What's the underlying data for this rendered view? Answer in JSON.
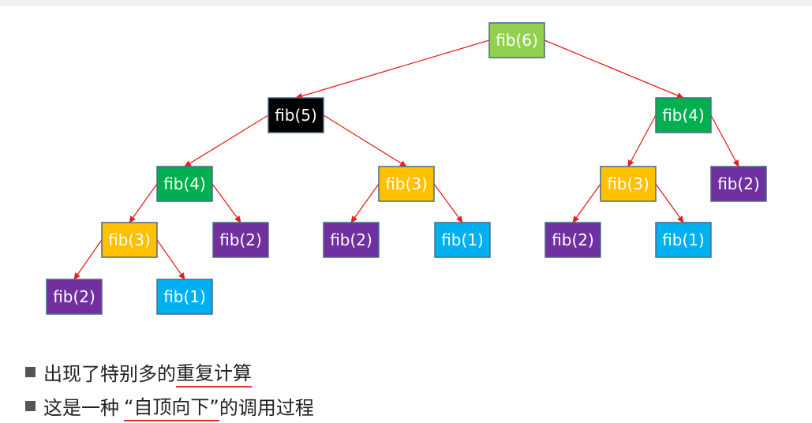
{
  "nodes": [
    {
      "id": "n1",
      "label": "fib(6)",
      "color": "#92d050",
      "parent": null
    },
    {
      "id": "n2",
      "label": "fib(5)",
      "color": "#000000",
      "parent": "n1"
    },
    {
      "id": "n3",
      "label": "fib(4)",
      "color": "#00b050",
      "parent": "n1"
    },
    {
      "id": "n4",
      "label": "fib(4)",
      "color": "#00b050",
      "parent": "n2"
    },
    {
      "id": "n5",
      "label": "fib(3)",
      "color": "#ffc000",
      "parent": "n2"
    },
    {
      "id": "n6",
      "label": "fib(3)",
      "color": "#ffc000",
      "parent": "n3"
    },
    {
      "id": "n7",
      "label": "fib(2)",
      "color": "#7030a0",
      "parent": "n3"
    },
    {
      "id": "n8",
      "label": "fib(3)",
      "color": "#ffc000",
      "parent": "n4"
    },
    {
      "id": "n9",
      "label": "fib(2)",
      "color": "#7030a0",
      "parent": "n4"
    },
    {
      "id": "n10",
      "label": "fib(2)",
      "color": "#7030a0",
      "parent": "n5"
    },
    {
      "id": "n11",
      "label": "fib(1)",
      "color": "#00b0f0",
      "parent": "n5"
    },
    {
      "id": "n12",
      "label": "fib(2)",
      "color": "#7030a0",
      "parent": "n6"
    },
    {
      "id": "n13",
      "label": "fib(1)",
      "color": "#00b0f0",
      "parent": "n6"
    },
    {
      "id": "n14",
      "label": "fib(2)",
      "color": "#7030a0",
      "parent": "n8"
    },
    {
      "id": "n15",
      "label": "fib(1)",
      "color": "#00b0f0",
      "parent": "n8"
    }
  ],
  "edge_color": "#e8201c",
  "bullets": [
    {
      "prefix": "出现了特别多的",
      "underlined": "重复计算",
      "suffix": ""
    },
    {
      "prefix": "这是一种",
      "underlined": "“自顶向下”",
      "suffix": "的调用过程"
    }
  ]
}
